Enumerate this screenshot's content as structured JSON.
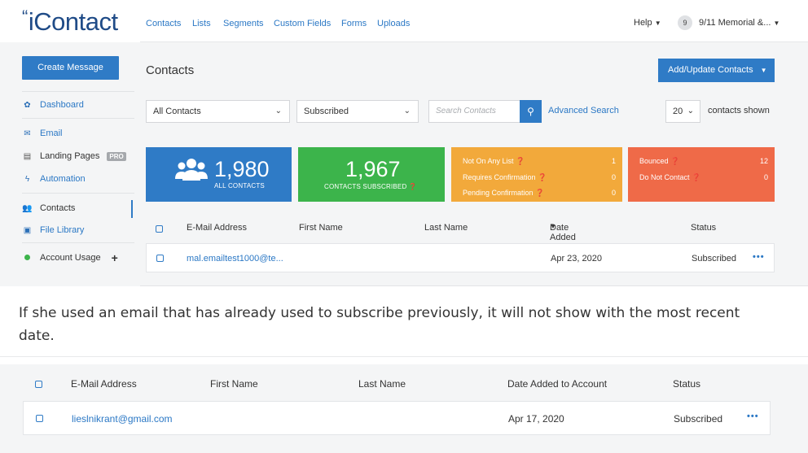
{
  "app": {
    "logo_text": "iContact",
    "nav_tabs": [
      "Contacts",
      "Lists",
      "Segments",
      "Custom Fields",
      "Forms",
      "Uploads"
    ],
    "help_label": "Help",
    "account_badge": "9",
    "account_name": "9/11 Memorial &..."
  },
  "sidebar": {
    "create_button": "Create Message",
    "items": [
      {
        "label": "Dashboard",
        "icon": "dashboard-icon"
      },
      {
        "label": "Email",
        "icon": "envelope-icon"
      },
      {
        "label": "Landing Pages",
        "icon": "landing-page-icon",
        "badge": "PRO"
      },
      {
        "label": "Automation",
        "icon": "bolt-icon"
      },
      {
        "label": "Contacts",
        "icon": "users-icon"
      },
      {
        "label": "File Library",
        "icon": "image-icon"
      },
      {
        "label": "Account Usage",
        "icon": "status-dot-icon"
      }
    ]
  },
  "main": {
    "title": "Contacts",
    "add_update_button": "Add/Update Contacts",
    "filter_contacts": "All Contacts",
    "filter_status": "Subscribed",
    "search_placeholder": "Search Contacts",
    "advanced_search": "Advanced Search",
    "per_page": "20",
    "contacts_shown": "contacts shown",
    "stats": {
      "all_contacts_value": "1,980",
      "all_contacts_label": "ALL CONTACTS",
      "subscribed_value": "1,967",
      "subscribed_label": "CONTACTS SUBSCRIBED",
      "not_on_list_label": "Not On Any List",
      "not_on_list_value": "1",
      "requires_confirmation_label": "Requires Confirmation",
      "requires_confirmation_value": "0",
      "pending_confirmation_label": "Pending Confirmation",
      "pending_confirmation_value": "0",
      "bounced_label": "Bounced",
      "bounced_value": "12",
      "do_not_contact_label": "Do Not Contact",
      "do_not_contact_value": "0"
    },
    "columns": [
      "E-Mail Address",
      "First Name",
      "Last Name",
      "Date Added to Account",
      "Status"
    ],
    "row": {
      "email": "mal.emailtest1000@te...",
      "first_name": "",
      "last_name": "",
      "date_added": "Apr 23, 2020",
      "status": "Subscribed"
    }
  },
  "caption": "If she used an email that has already used to subscribe previously, it will not show with the most recent date.",
  "second_table": {
    "columns": [
      "E-Mail Address",
      "First Name",
      "Last Name",
      "Date Added to Account",
      "Status"
    ],
    "row": {
      "email": "lieslnikrant@gmail.com",
      "date_added": "Apr 17, 2020",
      "status": "Subscribed"
    }
  },
  "colors": {
    "primary_blue": "#2f7bc6",
    "green": "#3cb44b",
    "orange": "#f2a93b",
    "red": "#ef6a48"
  }
}
